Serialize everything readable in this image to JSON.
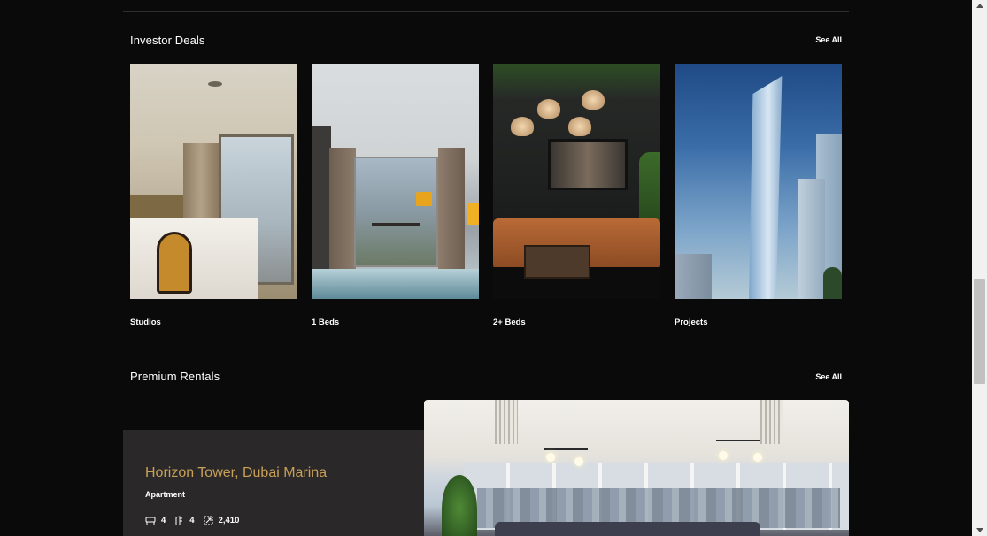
{
  "investor_deals": {
    "title": "Investor Deals",
    "see_all": "See All",
    "cards": [
      {
        "label": "Studios",
        "image": "studio-bedroom-photo"
      },
      {
        "label": "1 Beds",
        "image": "one-bed-living-photo"
      },
      {
        "label": "2+ Beds",
        "image": "lounge-photo"
      },
      {
        "label": "Projects",
        "image": "tower-project-render"
      }
    ]
  },
  "premium_rentals": {
    "title": "Premium Rentals",
    "see_all": "See All",
    "listing": {
      "title": "Horizon Tower, Dubai Marina",
      "type": "Apartment",
      "beds": "4",
      "baths": "4",
      "area": "2,410",
      "icons": [
        "bed-icon",
        "bath-icon",
        "area-icon"
      ],
      "image": "living-room-city-view-photo"
    }
  },
  "colors": {
    "background": "#0b0a0a",
    "card_background": "#2a2828",
    "accent_gold": "#c9a059",
    "divider": "#2f2e2e"
  }
}
